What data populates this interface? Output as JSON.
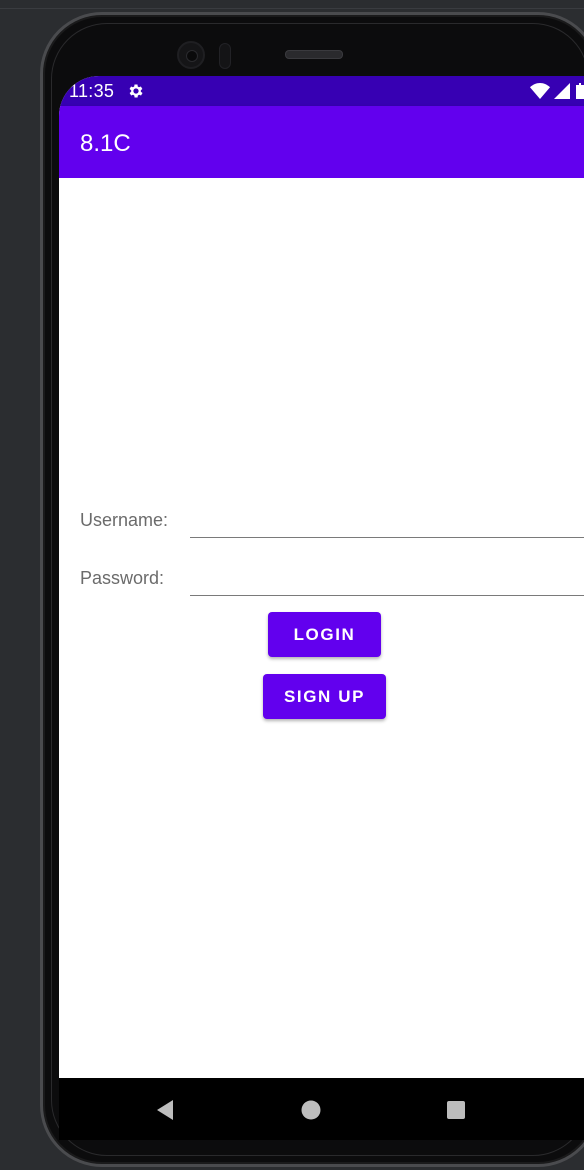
{
  "status_bar": {
    "time": "11:35",
    "settings_icon": "gear-icon",
    "wifi_icon": "wifi-icon",
    "signal_icon": "cell-signal-icon",
    "battery_icon": "battery-icon"
  },
  "app_bar": {
    "title": "8.1C"
  },
  "form": {
    "username_label": "Username:",
    "username_value": "",
    "password_label": "Password:",
    "password_value": "",
    "login_label": "LOGIN",
    "signup_label": "SIGN UP"
  },
  "nav_bar": {
    "back_icon": "back-triangle-icon",
    "home_icon": "home-circle-icon",
    "recents_icon": "recents-square-icon"
  },
  "colors": {
    "status_bar": "#3700b3",
    "primary": "#6200ee",
    "label_text": "#6b6b6b"
  }
}
